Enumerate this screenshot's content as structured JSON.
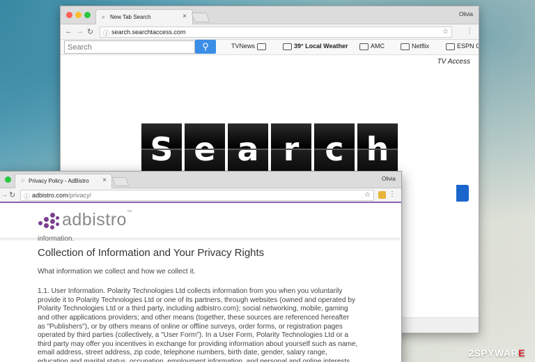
{
  "window_back": {
    "tab_title": "New Tab Search",
    "user": "Olivia",
    "url": "search.searchtaccess.com",
    "search_placeholder": "Search",
    "toolbar_links": [
      "TVNews",
      "39° Local Weather",
      "AMC",
      "Netflix",
      "ESPN G"
    ],
    "brand_text": "TV Access",
    "logo_letters": [
      "S",
      "e",
      "a",
      "r",
      "c",
      "h"
    ]
  },
  "window_front": {
    "tab_title": "Privacy Policy - AdBistro",
    "user": "Olivia",
    "url_host": "adbistro.com",
    "url_path": "/privacy/",
    "logo_text": "adbistro",
    "cut_text": "information.",
    "heading": "Collection of Information and Your Privacy Rights",
    "subheading": "What information we collect and how we collect it.",
    "paragraph": "1.1. User Information. Polarity Technologies Ltd collects information from you when you voluntarily provide it to Polarity Technologies Ltd or one of its partners, through websites (owned and operated by Polarity Technologies Ltd or a third party, including adbistro.com); social networking, mobile, gaming and other applications providers; and other means (together, these sources are referenced hereafter as \"Publishers\"), or by others means of online or offline surveys, order forms, or registration pages operated by third parties (collectively, a \"User Form\"). In a User Form, Polarity Technologies Ltd or a third party may offer you incentives in exchange for providing information about yourself such as name, email address, street address, zip code, telephone numbers, birth date, gender, salary range, education and marital status, occupation, employment information, and personal and online interests"
  },
  "watermark": {
    "prefix": "2SPYWAR",
    "suffix": "E"
  },
  "colors": {
    "accent_purple": "#8b63b5",
    "search_button": "#3a8ee6"
  }
}
